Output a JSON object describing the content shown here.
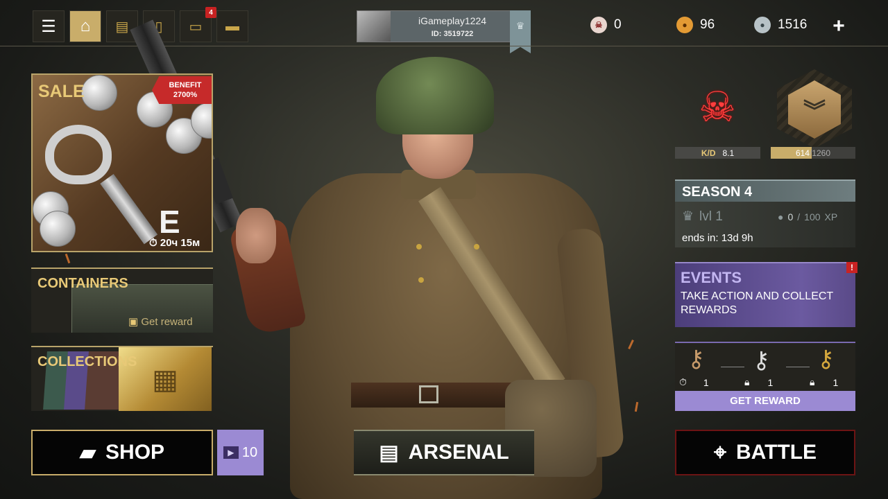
{
  "topbar": {
    "menu_icon": "hamburger-menu-icon",
    "notifications_badge": "4",
    "profile": {
      "username": "iGameplay1224",
      "user_id": "ID: 3519722"
    },
    "currencies": [
      {
        "icon": "skull-token-icon",
        "value": "0"
      },
      {
        "icon": "gold-coin-icon",
        "value": "96"
      },
      {
        "icon": "silver-coin-icon",
        "value": "1516"
      }
    ],
    "add_label": "+"
  },
  "sale": {
    "title": "SALE",
    "benefit_label": "BENEFIT",
    "benefit_value": "2700%",
    "key_letter": "E",
    "timer": "20ч 15м"
  },
  "containers": {
    "title": "CONTAINERS",
    "reward_label": "Get reward"
  },
  "collections": {
    "title": "COLLECTIONS"
  },
  "bottom": {
    "shop_label": "SHOP",
    "ad_count": "10",
    "arsenal_label": "ARSENAL",
    "battle_label": "BATTLE"
  },
  "stats": {
    "kd_label": "K/D",
    "kd_value": "8.1",
    "xp_current": "614",
    "xp_separator": "/",
    "xp_total": "1260",
    "xp_progress": 0.487
  },
  "season": {
    "title": "SEASON 4",
    "level": "lvl 1",
    "xp_current": "0",
    "xp_separator": "/",
    "xp_total": "100",
    "xp_unit": "XP",
    "ends_in": "ends in: 13d 9h"
  },
  "events": {
    "title": "EVENTS",
    "description": "TAKE ACTION AND COLLECT REWARDS",
    "alert": "!"
  },
  "keys": {
    "counts": [
      "1",
      "1",
      "1"
    ],
    "button_label": "GET REWARD"
  },
  "colors": {
    "gold_accent": "#c9ad6a",
    "purple_accent": "#9b8ad3",
    "alert_red": "#c62a2a"
  }
}
